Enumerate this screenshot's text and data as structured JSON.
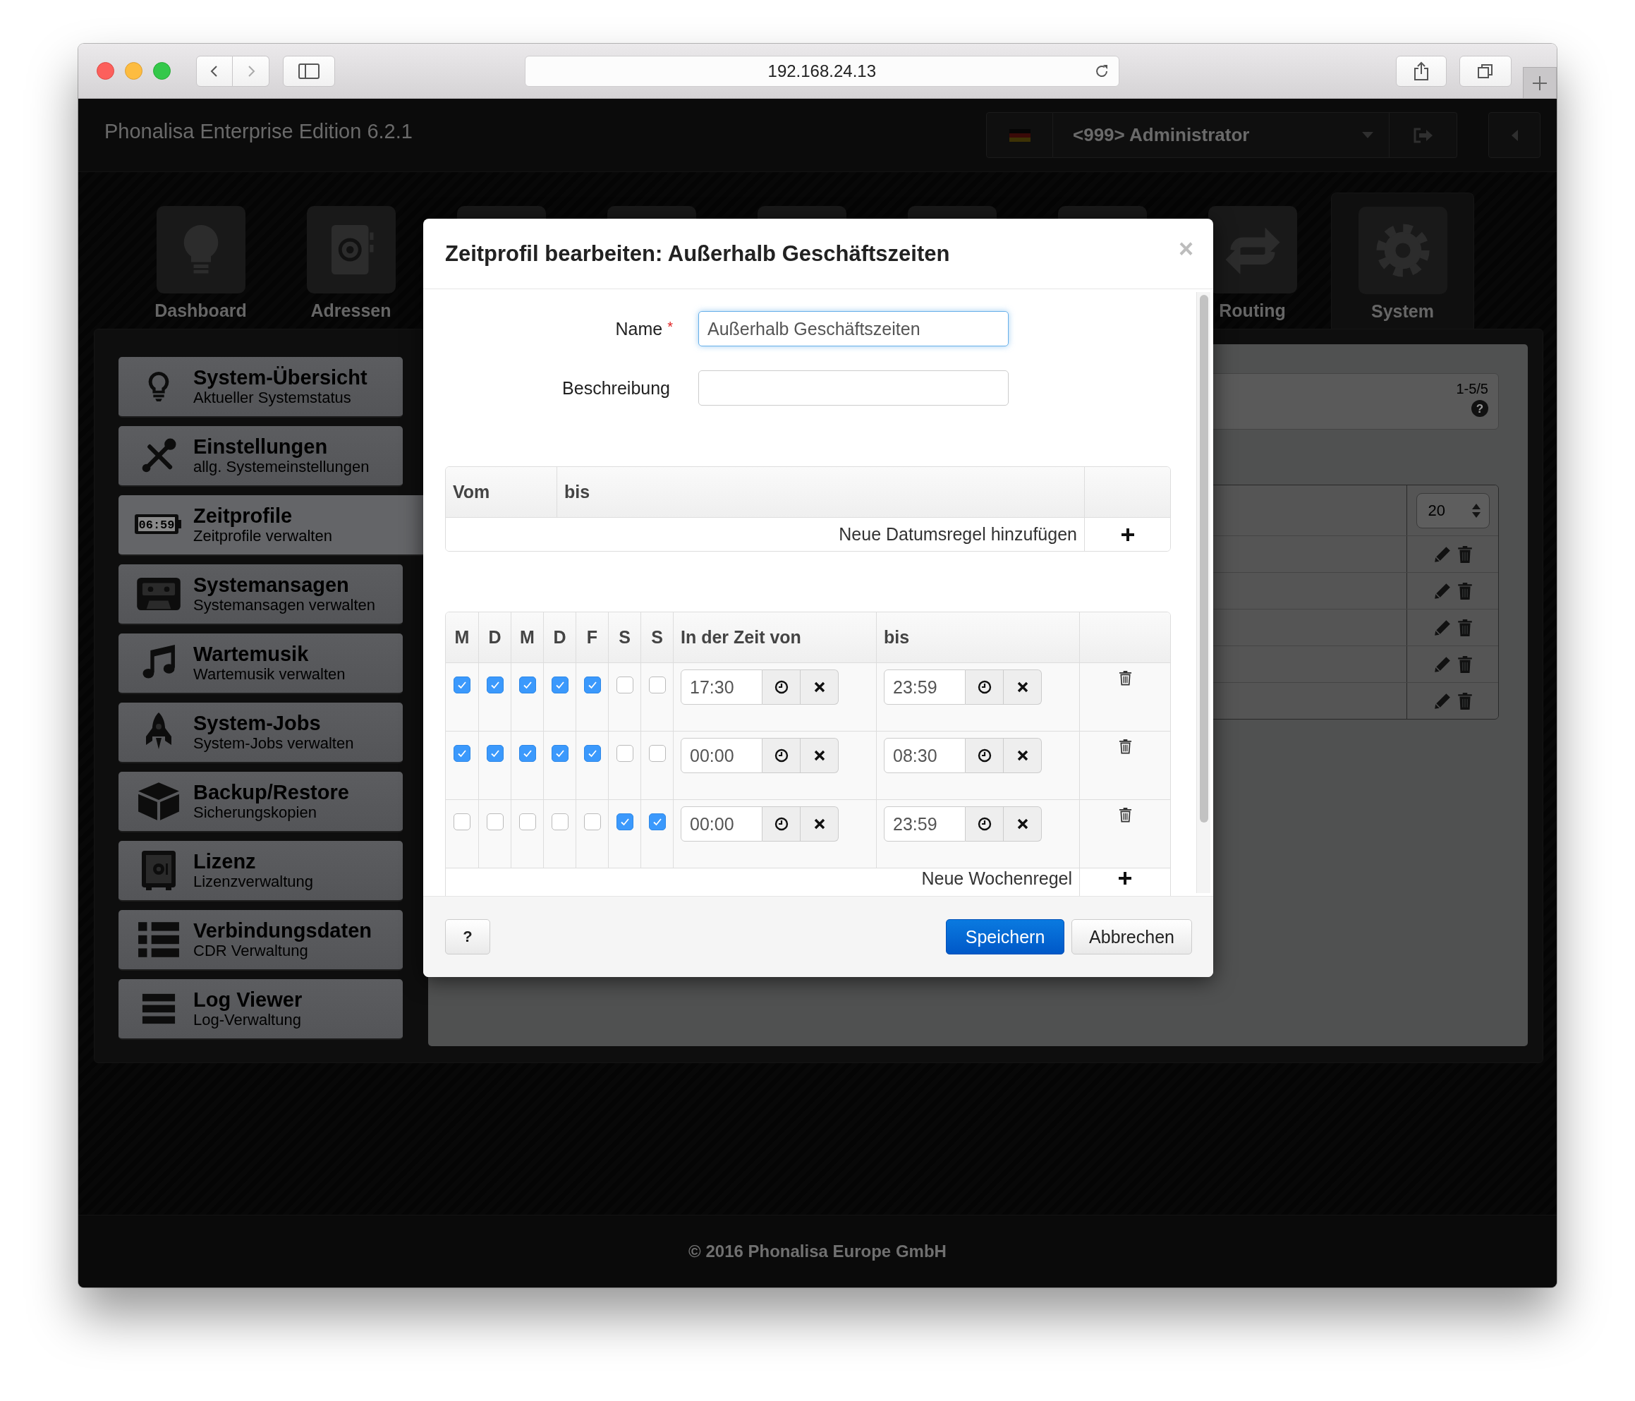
{
  "browser": {
    "url": "192.168.24.13"
  },
  "header": {
    "title": "Phonalisa Enterprise Edition 6.2.1",
    "user": "<999> Administrator"
  },
  "nav_tiles": [
    {
      "label": "Dashboard",
      "selected": false
    },
    {
      "label": "Adressen",
      "selected": false
    },
    {
      "selected": false
    },
    {
      "selected": false
    },
    {
      "selected": false
    },
    {
      "selected": false
    },
    {
      "selected": false
    },
    {
      "label": "Routing",
      "selected": false
    },
    {
      "label": "System",
      "selected": true
    }
  ],
  "sidebar": {
    "items": [
      {
        "title": "System-Übersicht",
        "subtitle": "Aktueller Systemstatus",
        "selected": false
      },
      {
        "title": "Einstellungen",
        "subtitle": "allg. Systemeinstellungen",
        "selected": false
      },
      {
        "title": "Zeitprofile",
        "subtitle": "Zeitprofile verwalten",
        "selected": true,
        "icon_text": "06:59"
      },
      {
        "title": "Systemansagen",
        "subtitle": "Systemansagen verwalten",
        "selected": false
      },
      {
        "title": "Wartemusik",
        "subtitle": "Wartemusik verwalten",
        "selected": false
      },
      {
        "title": "System-Jobs",
        "subtitle": "System-Jobs verwalten",
        "selected": false
      },
      {
        "title": "Backup/Restore",
        "subtitle": "Sicherungskopien",
        "selected": false
      },
      {
        "title": "Lizenz",
        "subtitle": "Lizenzverwaltung",
        "selected": false
      },
      {
        "title": "Verbindungsdaten",
        "subtitle": "CDR Verwaltung",
        "selected": false
      },
      {
        "title": "Log Viewer",
        "subtitle": "Log-Verwaltung",
        "selected": false
      }
    ]
  },
  "content": {
    "pager": "1-5/5",
    "help_mark": "?",
    "page_size": "20"
  },
  "modal": {
    "title": "Zeitprofil bearbeiten: Außerhalb Geschäftszeiten",
    "close": "×",
    "fields": [
      {
        "label": "Name",
        "required_mark": "*",
        "value": "Außerhalb Geschäftszeiten",
        "focused": true
      },
      {
        "label": "Beschreibung",
        "focused": false
      }
    ],
    "date_rules": {
      "columns": [
        "Vom",
        "bis"
      ],
      "add_label": "Neue Datumsregel hinzufügen"
    },
    "week_rules": {
      "day_columns": [
        "M",
        "D",
        "M",
        "D",
        "F",
        "S",
        "S"
      ],
      "columns": [
        "In der Zeit von",
        "bis"
      ],
      "rows": [
        {
          "days": [
            {
              "checked": true
            },
            {
              "checked": true
            },
            {
              "checked": true
            },
            {
              "checked": true
            },
            {
              "checked": true
            },
            {
              "checked": false
            },
            {
              "checked": false
            }
          ],
          "from": "17:30",
          "to": "23:59"
        },
        {
          "days": [
            {
              "checked": true
            },
            {
              "checked": true
            },
            {
              "checked": true
            },
            {
              "checked": true
            },
            {
              "checked": true
            },
            {
              "checked": false
            },
            {
              "checked": false
            }
          ],
          "from": "00:00",
          "to": "08:30"
        },
        {
          "days": [
            {
              "checked": false
            },
            {
              "checked": false
            },
            {
              "checked": false
            },
            {
              "checked": false
            },
            {
              "checked": false
            },
            {
              "checked": true
            },
            {
              "checked": true
            }
          ],
          "from": "00:00",
          "to": "23:59"
        }
      ],
      "add_label": "Neue Wochenregel"
    },
    "buttons": [
      {
        "label": "?",
        "kind": "help"
      },
      {
        "label": "Speichern",
        "kind": "primary"
      },
      {
        "label": "Abbrechen",
        "kind": "default"
      }
    ]
  },
  "footer": "© 2016 Phonalisa Europe GmbH"
}
